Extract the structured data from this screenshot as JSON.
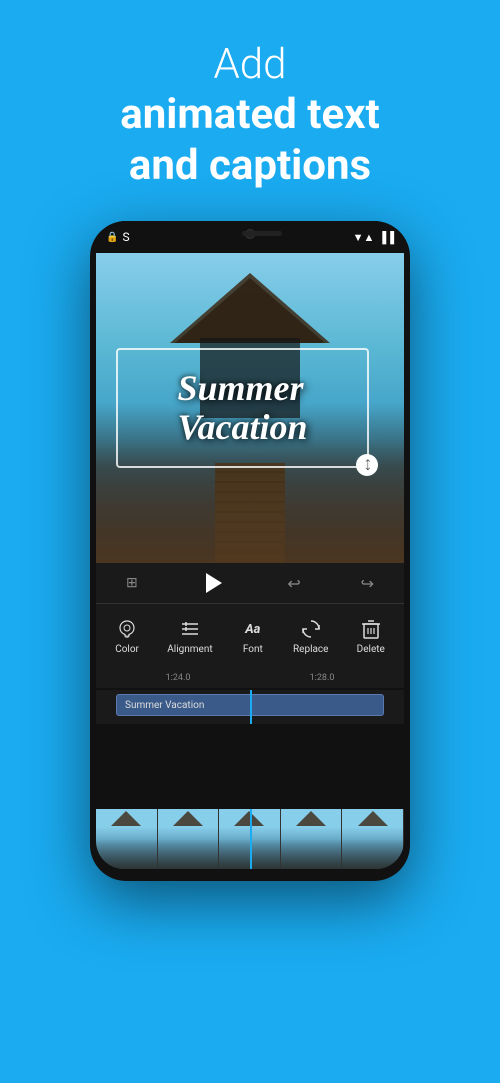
{
  "header": {
    "line1": "Add",
    "line2": "animated text",
    "line3_normal": "and ",
    "line3_bold": "captions"
  },
  "phone": {
    "status_left": [
      "🔒",
      "S"
    ],
    "status_right": [
      "▼",
      "▲",
      "▐▐"
    ]
  },
  "video": {
    "caption_text": "Summer Vacation"
  },
  "controls": {
    "undo_label": "↩",
    "redo_label": "↪"
  },
  "tools": [
    {
      "id": "color",
      "label": "Color",
      "icon": "💧"
    },
    {
      "id": "alignment",
      "label": "Alignment",
      "icon": "≡"
    },
    {
      "id": "font",
      "label": "Font",
      "icon": "Aa"
    },
    {
      "id": "replace",
      "label": "Replace",
      "icon": "↻"
    },
    {
      "id": "delete",
      "label": "Delete",
      "icon": "🗑"
    }
  ],
  "timeline": {
    "marks": [
      "1:24.0",
      "1:28.0"
    ],
    "caption_track_label": "Summer Vacation"
  }
}
